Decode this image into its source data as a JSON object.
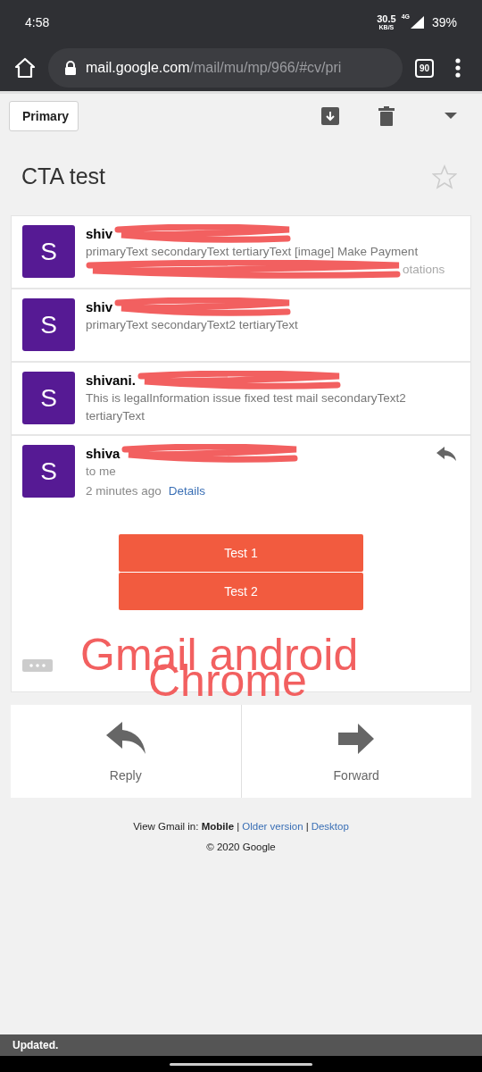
{
  "status_bar": {
    "time": "4:58",
    "speed": "30.5",
    "speed_unit": "KB/S",
    "network": "4G",
    "battery": "39%"
  },
  "browser": {
    "url_host": "mail.google.com",
    "url_path": "/mail/mu/mp/966/#cv/pri",
    "tab_count": "90"
  },
  "toolbar": {
    "back_label": "Primary"
  },
  "thread": {
    "subject": "CTA test",
    "starred": false,
    "messages": [
      {
        "sender": "shiv",
        "snippet": "primaryText secondaryText tertiaryText [image] Make Payment",
        "snippet_tail": "otations",
        "expanded": false,
        "avatar": "S"
      },
      {
        "sender": "shiv",
        "snippet": "primaryText secondaryText2 tertiaryText",
        "expanded": false,
        "avatar": "S"
      },
      {
        "sender": "shivani.",
        "snippet": "This is legalInformation issue fixed test mail secondaryText2 tertiaryText",
        "expanded": false,
        "avatar": "S"
      },
      {
        "sender": "shiva",
        "recipient": "to me",
        "time": "2 minutes ago",
        "details_link": "Details",
        "expanded": true,
        "avatar": "S"
      }
    ],
    "cta_buttons": [
      "Test 1",
      "Test 2"
    ]
  },
  "annotation": [
    "Gmail android",
    "Chrome"
  ],
  "actions": [
    {
      "label": "Reply",
      "kind": "reply"
    },
    {
      "label": "Forward",
      "kind": "forward"
    }
  ],
  "footer": {
    "line": "View Gmail in: **Mobile** |",
    "links": [
      "Older version",
      "Desktop"
    ],
    "separator": "|",
    "copyright": "© 2020 Google"
  },
  "toast": "Updated."
}
